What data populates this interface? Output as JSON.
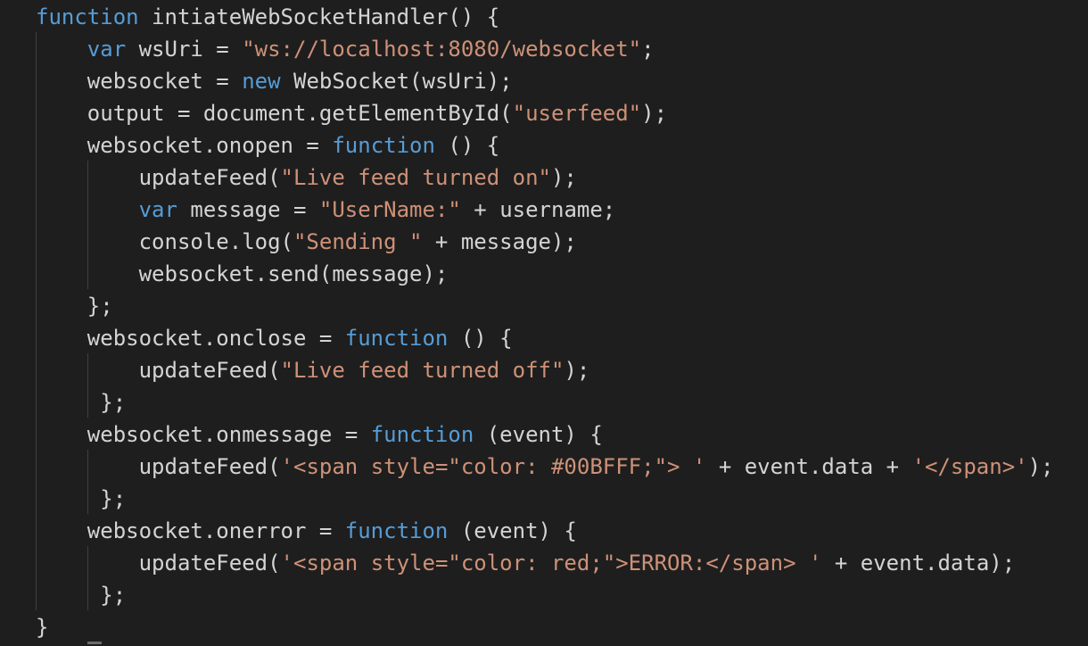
{
  "editor": {
    "background": "#1e1e1e",
    "token_colors": {
      "keyword": "#569cd6",
      "string": "#ce9178",
      "default": "#d4d4d4"
    },
    "lines": [
      [
        {
          "t": "function",
          "c": "keyword"
        },
        {
          "t": " intiateWebSocketHandler() {",
          "c": "default"
        }
      ],
      [
        {
          "t": "    ",
          "c": "default"
        },
        {
          "t": "var",
          "c": "keyword"
        },
        {
          "t": " wsUri = ",
          "c": "default"
        },
        {
          "t": "\"ws://localhost:8080/websocket\"",
          "c": "string"
        },
        {
          "t": ";",
          "c": "default"
        }
      ],
      [
        {
          "t": "    websocket = ",
          "c": "default"
        },
        {
          "t": "new",
          "c": "keyword"
        },
        {
          "t": " WebSocket(wsUri);",
          "c": "default"
        }
      ],
      [
        {
          "t": "    output = document.getElementById(",
          "c": "default"
        },
        {
          "t": "\"userfeed\"",
          "c": "string"
        },
        {
          "t": ");",
          "c": "default"
        }
      ],
      [
        {
          "t": "    websocket.onopen = ",
          "c": "default"
        },
        {
          "t": "function",
          "c": "keyword"
        },
        {
          "t": " () {",
          "c": "default"
        }
      ],
      [
        {
          "t": "        updateFeed(",
          "c": "default"
        },
        {
          "t": "\"Live feed turned on\"",
          "c": "string"
        },
        {
          "t": ");",
          "c": "default"
        }
      ],
      [
        {
          "t": "        ",
          "c": "default"
        },
        {
          "t": "var",
          "c": "keyword"
        },
        {
          "t": " message = ",
          "c": "default"
        },
        {
          "t": "\"UserName:\"",
          "c": "string"
        },
        {
          "t": " + username;",
          "c": "default"
        }
      ],
      [
        {
          "t": "        console.log(",
          "c": "default"
        },
        {
          "t": "\"Sending \"",
          "c": "string"
        },
        {
          "t": " + message);",
          "c": "default"
        }
      ],
      [
        {
          "t": "        websocket.send(message);",
          "c": "default"
        }
      ],
      [
        {
          "t": "    };",
          "c": "default"
        }
      ],
      [
        {
          "t": "    websocket.onclose = ",
          "c": "default"
        },
        {
          "t": "function",
          "c": "keyword"
        },
        {
          "t": " () {",
          "c": "default"
        }
      ],
      [
        {
          "t": "        updateFeed(",
          "c": "default"
        },
        {
          "t": "\"Live feed turned off\"",
          "c": "string"
        },
        {
          "t": ");",
          "c": "default"
        }
      ],
      [
        {
          "t": "     };",
          "c": "default"
        }
      ],
      [
        {
          "t": "    websocket.onmessage = ",
          "c": "default"
        },
        {
          "t": "function",
          "c": "keyword"
        },
        {
          "t": " (event) {",
          "c": "default"
        }
      ],
      [
        {
          "t": "        updateFeed(",
          "c": "default"
        },
        {
          "t": "'<span style=\"color: #00BFFF;\"> '",
          "c": "string"
        },
        {
          "t": " + event.data + ",
          "c": "default"
        },
        {
          "t": "'</span>'",
          "c": "string"
        },
        {
          "t": ");",
          "c": "default"
        }
      ],
      [
        {
          "t": "     };",
          "c": "default"
        }
      ],
      [
        {
          "t": "    websocket.onerror = ",
          "c": "default"
        },
        {
          "t": "function",
          "c": "keyword"
        },
        {
          "t": " (event) {",
          "c": "default"
        }
      ],
      [
        {
          "t": "        updateFeed(",
          "c": "default"
        },
        {
          "t": "'<span style=\"color: red;\">ERROR:</span> '",
          "c": "string"
        },
        {
          "t": " + event.data);",
          "c": "default"
        }
      ],
      [
        {
          "t": "     };",
          "c": "default"
        }
      ],
      [
        {
          "t": "}",
          "c": "default"
        }
      ]
    ]
  }
}
